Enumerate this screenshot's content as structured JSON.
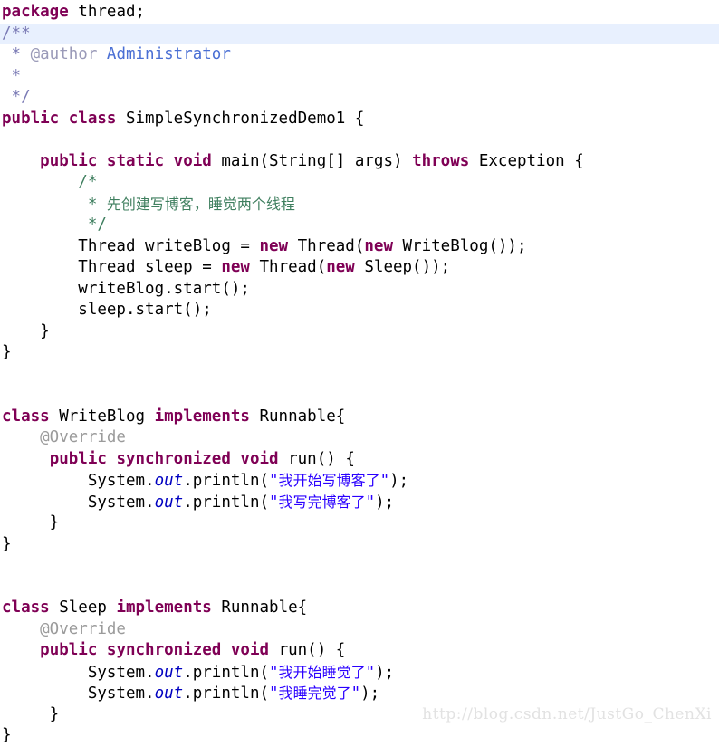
{
  "document": {
    "kind": "java-source-listing",
    "language": "Java",
    "background_color": "#ffffff",
    "highlight_color": "#e8f0fe",
    "colors": {
      "keyword": "#7f0055",
      "string": "#2a00ff",
      "static_field": "#0000c0",
      "javadoc": "#7a7ab5",
      "javadoc_tag": "#9a9ab8",
      "javadoc_value": "#4a6fd4",
      "block_comment": "#3f7f5f",
      "annotation": "#9b9b9b",
      "plain": "#000000",
      "watermark": "#e2e2e2"
    }
  },
  "watermark": {
    "text": "http://blog.csdn.net/JustGo_ChenXi"
  },
  "code": {
    "lines": [
      {
        "n": 1,
        "highlighted": false,
        "tokens": [
          {
            "c": "kw",
            "t": "package"
          },
          {
            "c": "plain",
            "t": " thread;"
          }
        ]
      },
      {
        "n": 2,
        "highlighted": true,
        "tokens": [
          {
            "c": "jdoc",
            "t": "/**"
          }
        ]
      },
      {
        "n": 3,
        "highlighted": false,
        "tokens": [
          {
            "c": "jdoc",
            "t": " * "
          },
          {
            "c": "jdoc-tag",
            "t": "@author"
          },
          {
            "c": "jdoc-val",
            "t": " Administrator"
          }
        ]
      },
      {
        "n": 4,
        "highlighted": false,
        "tokens": [
          {
            "c": "jdoc",
            "t": " *"
          }
        ]
      },
      {
        "n": 5,
        "highlighted": false,
        "tokens": [
          {
            "c": "jdoc",
            "t": " */"
          }
        ]
      },
      {
        "n": 6,
        "highlighted": false,
        "tokens": [
          {
            "c": "kw",
            "t": "public class"
          },
          {
            "c": "plain",
            "t": " SimpleSynchronizedDemo1 {"
          }
        ]
      },
      {
        "n": 7,
        "highlighted": false,
        "tokens": []
      },
      {
        "n": 8,
        "highlighted": false,
        "tokens": [
          {
            "c": "plain",
            "t": "    "
          },
          {
            "c": "kw",
            "t": "public static void"
          },
          {
            "c": "plain",
            "t": " main(String[] args) "
          },
          {
            "c": "kw",
            "t": "throws"
          },
          {
            "c": "plain",
            "t": " Exception {"
          }
        ]
      },
      {
        "n": 9,
        "highlighted": false,
        "tokens": [
          {
            "c": "comment",
            "t": "        /*"
          }
        ]
      },
      {
        "n": 10,
        "highlighted": false,
        "tokens": [
          {
            "c": "comment",
            "t": "         * "
          },
          {
            "c": "comment cjk",
            "t": "先创建写博客，睡觉两个线程"
          }
        ]
      },
      {
        "n": 11,
        "highlighted": false,
        "tokens": [
          {
            "c": "comment",
            "t": "         */"
          }
        ]
      },
      {
        "n": 12,
        "highlighted": false,
        "tokens": [
          {
            "c": "plain",
            "t": "        Thread writeBlog = "
          },
          {
            "c": "kw",
            "t": "new"
          },
          {
            "c": "plain",
            "t": " Thread("
          },
          {
            "c": "kw",
            "t": "new"
          },
          {
            "c": "plain",
            "t": " WriteBlog());"
          }
        ]
      },
      {
        "n": 13,
        "highlighted": false,
        "tokens": [
          {
            "c": "plain",
            "t": "        Thread sleep = "
          },
          {
            "c": "kw",
            "t": "new"
          },
          {
            "c": "plain",
            "t": " Thread("
          },
          {
            "c": "kw",
            "t": "new"
          },
          {
            "c": "plain",
            "t": " Sleep());"
          }
        ]
      },
      {
        "n": 14,
        "highlighted": false,
        "tokens": [
          {
            "c": "plain",
            "t": "        writeBlog.start();"
          }
        ]
      },
      {
        "n": 15,
        "highlighted": false,
        "tokens": [
          {
            "c": "plain",
            "t": "        sleep.start();"
          }
        ]
      },
      {
        "n": 16,
        "highlighted": false,
        "tokens": [
          {
            "c": "plain",
            "t": "    }"
          }
        ]
      },
      {
        "n": 17,
        "highlighted": false,
        "tokens": [
          {
            "c": "plain",
            "t": "}"
          }
        ]
      },
      {
        "n": 18,
        "highlighted": false,
        "tokens": []
      },
      {
        "n": 19,
        "highlighted": false,
        "tokens": []
      },
      {
        "n": 20,
        "highlighted": false,
        "tokens": [
          {
            "c": "kw",
            "t": "class"
          },
          {
            "c": "plain",
            "t": " WriteBlog "
          },
          {
            "c": "kw",
            "t": "implements"
          },
          {
            "c": "plain",
            "t": " Runnable{"
          }
        ]
      },
      {
        "n": 21,
        "highlighted": false,
        "tokens": [
          {
            "c": "anno",
            "t": "    @Override"
          }
        ]
      },
      {
        "n": 22,
        "highlighted": false,
        "tokens": [
          {
            "c": "plain",
            "t": "     "
          },
          {
            "c": "kw",
            "t": "public synchronized void"
          },
          {
            "c": "plain",
            "t": " run() {"
          }
        ]
      },
      {
        "n": 23,
        "highlighted": false,
        "tokens": [
          {
            "c": "plain",
            "t": "         System."
          },
          {
            "c": "field",
            "t": "out"
          },
          {
            "c": "plain",
            "t": ".println("
          },
          {
            "c": "str",
            "t": "\""
          },
          {
            "c": "str cjk",
            "t": "我开始写博客了"
          },
          {
            "c": "str",
            "t": "\""
          },
          {
            "c": "plain",
            "t": ");"
          }
        ]
      },
      {
        "n": 24,
        "highlighted": false,
        "tokens": [
          {
            "c": "plain",
            "t": "         System."
          },
          {
            "c": "field",
            "t": "out"
          },
          {
            "c": "plain",
            "t": ".println("
          },
          {
            "c": "str",
            "t": "\""
          },
          {
            "c": "str cjk",
            "t": "我写完博客了"
          },
          {
            "c": "str",
            "t": "\""
          },
          {
            "c": "plain",
            "t": ");"
          }
        ]
      },
      {
        "n": 25,
        "highlighted": false,
        "tokens": [
          {
            "c": "plain",
            "t": "     }"
          }
        ]
      },
      {
        "n": 26,
        "highlighted": false,
        "tokens": [
          {
            "c": "plain",
            "t": "}"
          }
        ]
      },
      {
        "n": 27,
        "highlighted": false,
        "tokens": []
      },
      {
        "n": 28,
        "highlighted": false,
        "tokens": []
      },
      {
        "n": 29,
        "highlighted": false,
        "tokens": [
          {
            "c": "kw",
            "t": "class"
          },
          {
            "c": "plain",
            "t": " Sleep "
          },
          {
            "c": "kw",
            "t": "implements"
          },
          {
            "c": "plain",
            "t": " Runnable{"
          }
        ]
      },
      {
        "n": 30,
        "highlighted": false,
        "tokens": [
          {
            "c": "anno",
            "t": "    @Override"
          }
        ]
      },
      {
        "n": 31,
        "highlighted": false,
        "tokens": [
          {
            "c": "plain",
            "t": "    "
          },
          {
            "c": "kw",
            "t": "public synchronized void"
          },
          {
            "c": "plain",
            "t": " run() {"
          }
        ]
      },
      {
        "n": 32,
        "highlighted": false,
        "tokens": [
          {
            "c": "plain",
            "t": "         System."
          },
          {
            "c": "field",
            "t": "out"
          },
          {
            "c": "plain",
            "t": ".println("
          },
          {
            "c": "str",
            "t": "\""
          },
          {
            "c": "str cjk",
            "t": "我开始睡觉了"
          },
          {
            "c": "str",
            "t": "\""
          },
          {
            "c": "plain",
            "t": ");"
          }
        ]
      },
      {
        "n": 33,
        "highlighted": false,
        "tokens": [
          {
            "c": "plain",
            "t": "         System."
          },
          {
            "c": "field",
            "t": "out"
          },
          {
            "c": "plain",
            "t": ".println("
          },
          {
            "c": "str",
            "t": "\""
          },
          {
            "c": "str cjk",
            "t": "我睡完觉了"
          },
          {
            "c": "str",
            "t": "\""
          },
          {
            "c": "plain",
            "t": ");"
          }
        ]
      },
      {
        "n": 34,
        "highlighted": false,
        "tokens": [
          {
            "c": "plain",
            "t": "     }"
          }
        ]
      },
      {
        "n": 35,
        "highlighted": false,
        "tokens": [
          {
            "c": "plain",
            "t": "}"
          }
        ]
      }
    ]
  }
}
